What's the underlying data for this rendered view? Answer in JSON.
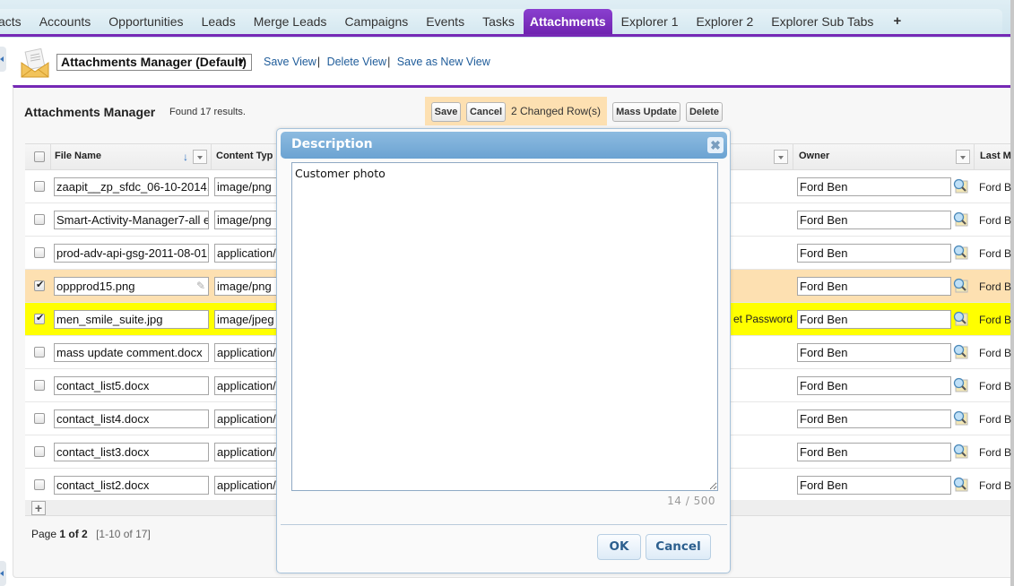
{
  "tabs": [
    {
      "label": "acts",
      "active": false
    },
    {
      "label": "Accounts",
      "active": false
    },
    {
      "label": "Opportunities",
      "active": false
    },
    {
      "label": "Leads",
      "active": false
    },
    {
      "label": "Merge Leads",
      "active": false
    },
    {
      "label": "Campaigns",
      "active": false
    },
    {
      "label": "Events",
      "active": false
    },
    {
      "label": "Tasks",
      "active": false
    },
    {
      "label": "Attachments",
      "active": true
    },
    {
      "label": "Explorer 1",
      "active": false
    },
    {
      "label": "Explorer 2",
      "active": false
    },
    {
      "label": "Explorer Sub Tabs",
      "active": false
    },
    {
      "label": "+",
      "active": false
    }
  ],
  "view": {
    "icon": "envelope-icon",
    "selected": "Attachments Manager (Default)",
    "links": [
      "Save View",
      "Delete View",
      "Save as New View"
    ]
  },
  "panel": {
    "title": "Attachments Manager",
    "found": "Found 17 results.",
    "save_label": "Save",
    "cancel_label": "Cancel",
    "changed_rows": "2 Changed Row(s)",
    "mass_update_label": "Mass Update",
    "delete_label": "Delete"
  },
  "table": {
    "columns": {
      "file_name": "File Name",
      "content_type": "Content Typ",
      "owner": "Owner",
      "last_modified": "Last M"
    },
    "rows": [
      {
        "checked": false,
        "state": "",
        "file_name": "zaapit__zp_sfdc_06-10-2014.",
        "content_type": "image/png",
        "hidden_text": "",
        "owner": "Ford Ben",
        "last_mod": "Ford B"
      },
      {
        "checked": false,
        "state": "",
        "file_name": "Smart-Activity-Manager7-all e",
        "content_type": "image/png",
        "hidden_text": "",
        "owner": "Ford Ben",
        "last_mod": "Ford B"
      },
      {
        "checked": false,
        "state": "",
        "file_name": "prod-adv-api-gsg-2011-08-01.",
        "content_type": "application/",
        "hidden_text": "",
        "owner": "Ford Ben",
        "last_mod": "Ford B"
      },
      {
        "checked": true,
        "state": "orange",
        "file_name": "oppprod15.png",
        "content_type": "image/png",
        "hidden_text": "",
        "owner": "Ford Ben",
        "last_mod": "Ford B"
      },
      {
        "checked": true,
        "state": "yellow",
        "file_name": "men_smile_suite.jpg",
        "content_type": "image/jpeg",
        "hidden_text": "et Password",
        "owner": "Ford Ben",
        "last_mod": "Ford B"
      },
      {
        "checked": false,
        "state": "",
        "file_name": "mass update comment.docx",
        "content_type": "application/",
        "hidden_text": "",
        "owner": "Ford Ben",
        "last_mod": "Ford B"
      },
      {
        "checked": false,
        "state": "",
        "file_name": "contact_list5.docx",
        "content_type": "application/",
        "hidden_text": "",
        "owner": "Ford Ben",
        "last_mod": "Ford B"
      },
      {
        "checked": false,
        "state": "",
        "file_name": "contact_list4.docx",
        "content_type": "application/",
        "hidden_text": "",
        "owner": "Ford Ben",
        "last_mod": "Ford B"
      },
      {
        "checked": false,
        "state": "",
        "file_name": "contact_list3.docx",
        "content_type": "application/",
        "hidden_text": "",
        "owner": "Ford Ben",
        "last_mod": "Ford B"
      },
      {
        "checked": false,
        "state": "",
        "file_name": "contact_list2.docx",
        "content_type": "application/",
        "hidden_text": "",
        "owner": "Ford Ben",
        "last_mod": "Ford B"
      }
    ]
  },
  "pager": {
    "prefix": "Page",
    "current": "1 of 2",
    "range": "[1-10 of 17]"
  },
  "modal": {
    "title": "Description",
    "value": "Customer photo",
    "counter": "14 / 500",
    "ok_label": "OK",
    "cancel_label": "Cancel"
  },
  "colors": {
    "accent": "#7529b5",
    "changed_row": "#fde0b1",
    "selected_row": "#ffff00",
    "link": "#1f5c9a"
  }
}
